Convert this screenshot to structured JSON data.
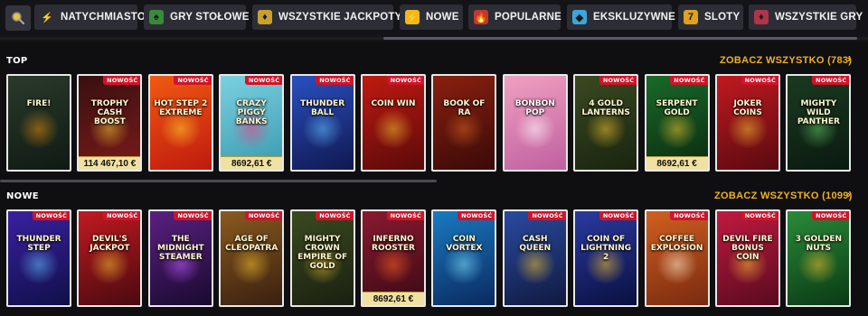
{
  "categories": [
    {
      "label": "NATYCHMIASTOWE",
      "icon": "lightning-bolt-icon",
      "color": "#2c2d35"
    },
    {
      "label": "GRY STOŁOWE",
      "icon": "card-table-icon",
      "color": "#3a8a3a"
    },
    {
      "label": "WSZYSTKIE JACKPOTY",
      "icon": "jackpot-icon",
      "color": "#c9a030"
    },
    {
      "label": "NOWE",
      "icon": "lightning-bolt-icon",
      "color": "#f2b817"
    },
    {
      "label": "POPULARNE",
      "icon": "fire-icon",
      "color": "#c0392b"
    },
    {
      "label": "EKSKLUZYWNE",
      "icon": "diamond-icon",
      "color": "#3da6d8"
    },
    {
      "label": "SLOTY",
      "icon": "slot-seven-icon",
      "color": "#e0a020"
    },
    {
      "label": "WSZYSTKIE GRY",
      "icon": "gem-icon",
      "color": "#b0344a"
    }
  ],
  "top": {
    "title": "TOP",
    "see_all": "ZOBACZ WSZYSTKO (783)",
    "games": [
      {
        "title": "FIRE!",
        "badge": "",
        "jackpot": "",
        "c1": "#2a3a2a",
        "c2": "#0f1a14",
        "accent": "#e08a10"
      },
      {
        "title": "TROPHY CASH BOOST",
        "badge": "NOWOŚĆ",
        "jackpot": "114 467,10 €",
        "c1": "#3a1010",
        "c2": "#7a1a1a",
        "accent": "#f0c030"
      },
      {
        "title": "HOT STEP 2 EXTREME",
        "badge": "NOWOŚĆ",
        "jackpot": "",
        "c1": "#f05a10",
        "c2": "#c01a10",
        "accent": "#ffd030"
      },
      {
        "title": "CRAZY PIGGY BANKS",
        "badge": "NOWOŚĆ",
        "jackpot": "8692,61 €",
        "c1": "#7ad0e0",
        "c2": "#3a9ab0",
        "accent": "#e84080"
      },
      {
        "title": "THUNDER BALL",
        "badge": "NOWOŚĆ",
        "jackpot": "",
        "c1": "#2a50c0",
        "c2": "#101850",
        "accent": "#60c0ff"
      },
      {
        "title": "COIN WIN",
        "badge": "NOWOŚĆ",
        "jackpot": "",
        "c1": "#c01a10",
        "c2": "#5a0a0a",
        "accent": "#f0c030"
      },
      {
        "title": "BOOK OF RA",
        "badge": "",
        "jackpot": "",
        "c1": "#8a2010",
        "c2": "#3a0a08",
        "accent": "#d06020"
      },
      {
        "title": "BONBON POP",
        "badge": "",
        "jackpot": "",
        "c1": "#f0a0c0",
        "c2": "#c060a0",
        "accent": "#ffffff"
      },
      {
        "title": "4 GOLD LANTERNS",
        "badge": "NOWOŚĆ",
        "jackpot": "",
        "c1": "#3a4a20",
        "c2": "#1a2410",
        "accent": "#f0c030"
      },
      {
        "title": "SERPENT GOLD",
        "badge": "NOWOŚĆ",
        "jackpot": "8692,61 €",
        "c1": "#1a6a2a",
        "c2": "#0a2a10",
        "accent": "#f0c030"
      },
      {
        "title": "JOKER COINS",
        "badge": "NOWOŚĆ",
        "jackpot": "",
        "c1": "#c01a20",
        "c2": "#5a0a10",
        "accent": "#f0c030"
      },
      {
        "title": "MIGHTY WILD PANTHER",
        "badge": "NOWOŚĆ",
        "jackpot": "",
        "c1": "#1a3a20",
        "c2": "#0a1a10",
        "accent": "#60c060"
      }
    ]
  },
  "new": {
    "title": "NOWE",
    "see_all": "ZOBACZ WSZYSTKO (1099)",
    "games": [
      {
        "title": "THUNDER STEP",
        "badge": "NOWOŚĆ",
        "jackpot": "",
        "c1": "#3a20a0",
        "c2": "#10104a",
        "accent": "#60c0ff"
      },
      {
        "title": "DEVIL'S JACKPOT",
        "badge": "NOWOŚĆ",
        "jackpot": "",
        "c1": "#c01a20",
        "c2": "#4a0a10",
        "accent": "#f0c030"
      },
      {
        "title": "THE MIDNIGHT STEAMER",
        "badge": "NOWOŚĆ",
        "jackpot": "",
        "c1": "#5a2080",
        "c2": "#1a0a30",
        "accent": "#c060ff"
      },
      {
        "title": "AGE OF CLEOPATRA",
        "badge": "NOWOŚĆ",
        "jackpot": "",
        "c1": "#8a5a20",
        "c2": "#3a2010",
        "accent": "#f0c030"
      },
      {
        "title": "MIGHTY CROWN EMPIRE OF GOLD",
        "badge": "NOWOŚĆ",
        "jackpot": "",
        "c1": "#3a4a20",
        "c2": "#1a2010",
        "accent": "#f0c030"
      },
      {
        "title": "INFERNO ROOSTER",
        "badge": "NOWOŚĆ",
        "jackpot": "8692,61 €",
        "c1": "#8a1a30",
        "c2": "#3a0a14",
        "accent": "#ff6020"
      },
      {
        "title": "COIN VORTEX",
        "badge": "NOWOŚĆ",
        "jackpot": "",
        "c1": "#1a7ac0",
        "c2": "#0a2a60",
        "accent": "#80e0ff"
      },
      {
        "title": "CASH QUEEN",
        "badge": "NOWOŚĆ",
        "jackpot": "",
        "c1": "#2a4aa0",
        "c2": "#101a40",
        "accent": "#f0c030"
      },
      {
        "title": "COIN OF LIGHTNING 2",
        "badge": "NOWOŚĆ",
        "jackpot": "",
        "c1": "#2a3aa0",
        "c2": "#0a1040",
        "accent": "#f0c030"
      },
      {
        "title": "COFFEE EXPLOSION",
        "badge": "NOWOŚĆ",
        "jackpot": "",
        "c1": "#d06020",
        "c2": "#7a2a10",
        "accent": "#fff0d0"
      },
      {
        "title": "DEVIL FIRE BONUS COIN",
        "badge": "NOWOŚĆ",
        "jackpot": "",
        "c1": "#c01a40",
        "c2": "#5a0a20",
        "accent": "#f0c030"
      },
      {
        "title": "3 GOLDEN NUTS",
        "badge": "NOWOŚĆ",
        "jackpot": "",
        "c1": "#2a8a3a",
        "c2": "#0a3a14",
        "accent": "#f0c030"
      }
    ]
  }
}
